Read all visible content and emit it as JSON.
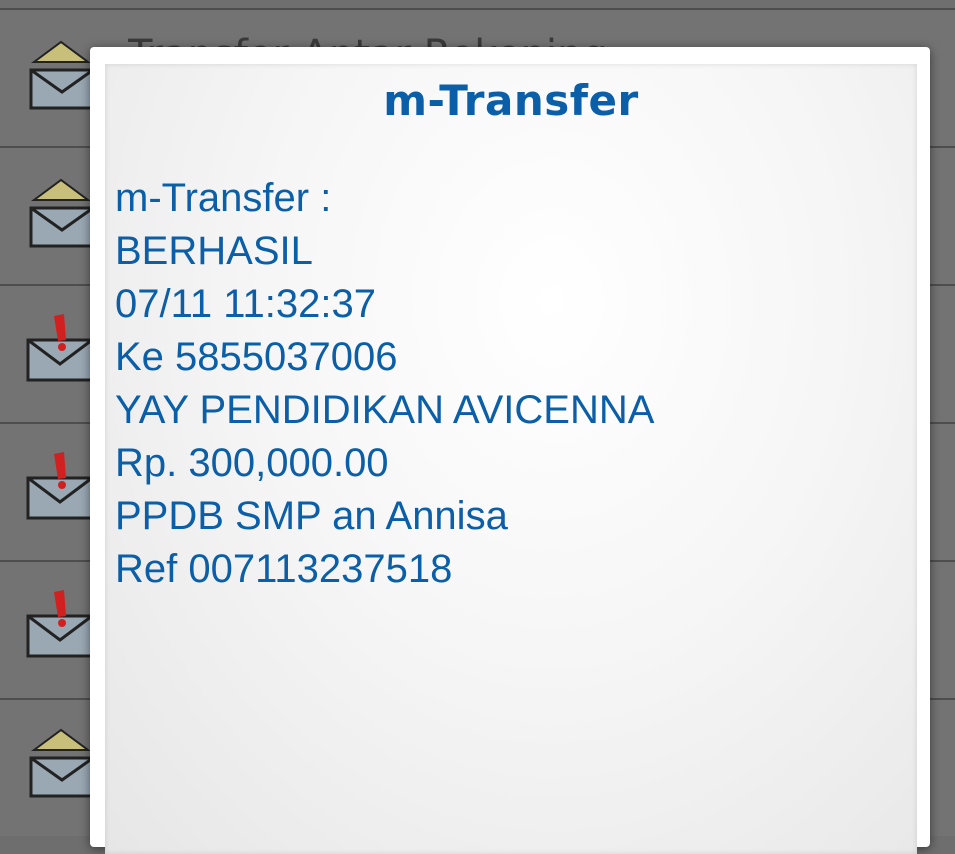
{
  "background_list": {
    "first_item_title": "Transfer Antar Rekening",
    "items": [
      {
        "icon": "envelope-open-icon"
      },
      {
        "icon": "envelope-open-icon"
      },
      {
        "icon": "envelope-alert-icon"
      },
      {
        "icon": "envelope-alert-icon"
      },
      {
        "icon": "envelope-alert-icon"
      },
      {
        "icon": "envelope-open-icon"
      }
    ]
  },
  "dialog": {
    "title": "m-Transfer",
    "lines": [
      "m-Transfer :",
      "BERHASIL",
      "07/11 11:32:37",
      "Ke 5855037006",
      "YAY PENDIDIKAN AVICENNA",
      "Rp. 300,000.00",
      "PPDB SMP an Annisa",
      "Ref 007113237518"
    ]
  },
  "colors": {
    "accent_text": "#0b5ea8",
    "dialog_bg": "#f4f4f4",
    "overlay_bg": "#737373"
  }
}
